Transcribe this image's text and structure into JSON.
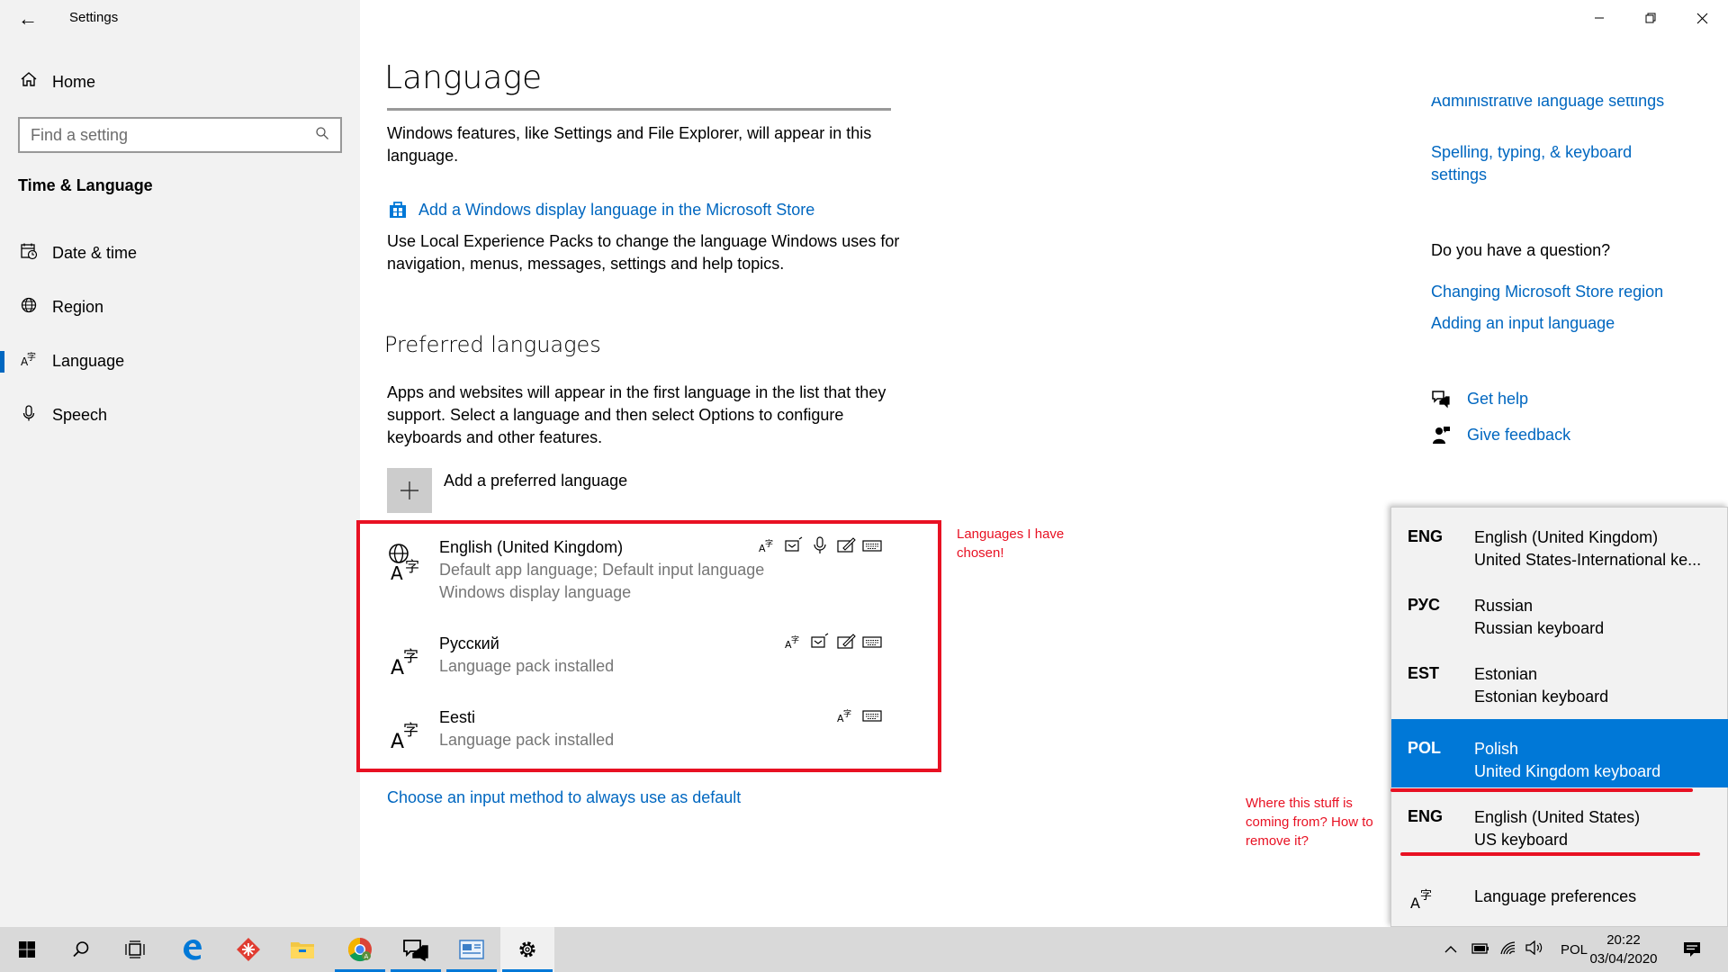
{
  "window": {
    "title": "Settings"
  },
  "sidebar": {
    "home": "Home",
    "search_placeholder": "Find a setting",
    "section": "Time & Language",
    "items": [
      {
        "label": "Date & time",
        "icon": "calendar-clock-icon"
      },
      {
        "label": "Region",
        "icon": "globe-icon"
      },
      {
        "label": "Language",
        "icon": "language-icon",
        "active": true
      },
      {
        "label": "Speech",
        "icon": "microphone-icon"
      }
    ]
  },
  "main": {
    "title": "Language",
    "display_desc": "Windows features, like Settings and File Explorer, will appear in this language.",
    "store_link": "Add a Windows display language in the Microsoft Store",
    "lxp_desc": "Use Local Experience Packs to change the language Windows uses for navigation, menus, messages, settings and help topics.",
    "preferred_heading": "Preferred languages",
    "preferred_desc": "Apps and websites will appear in the first language in the list that they support. Select a language and then select Options to configure keyboards and other features.",
    "add_preferred": "Add a preferred language",
    "languages": [
      {
        "name": "English (United Kingdom)",
        "sub1": "Default app language; Default input language",
        "sub2": "Windows display language"
      },
      {
        "name": "Русский",
        "sub1": "Language pack installed"
      },
      {
        "name": "Eesti",
        "sub1": "Language pack installed"
      }
    ],
    "choose_input": "Choose an input method to always use as default"
  },
  "annotations": {
    "chosen_line1": "Languages I have",
    "chosen_line2": "chosen!",
    "where_line1": "Where this stuff is",
    "where_line2": "coming from? How to",
    "where_line3": "remove it?"
  },
  "right": {
    "admin_link": "Administrative language settings",
    "spelling_link_1": "Spelling, typing, & keyboard",
    "spelling_link_2": "settings",
    "question": "Do you have a question?",
    "q_link1": "Changing Microsoft Store region",
    "q_link2": "Adding an input language",
    "get_help": "Get help",
    "give_feedback": "Give feedback"
  },
  "flyout": {
    "items": [
      {
        "code": "ENG",
        "lang": "English (United Kingdom)",
        "kbd": "United States-International ke..."
      },
      {
        "code": "РУС",
        "lang": "Russian",
        "kbd": "Russian keyboard"
      },
      {
        "code": "EST",
        "lang": "Estonian",
        "kbd": "Estonian keyboard"
      },
      {
        "code": "POL",
        "lang": "Polish",
        "kbd": "United Kingdom keyboard",
        "selected": true
      },
      {
        "code": "ENG",
        "lang": "English (United States)",
        "kbd": "US keyboard"
      }
    ],
    "prefs": "Language preferences"
  },
  "taskbar": {
    "input_indicator": "POL",
    "time": "20:22",
    "date": "03/04/2020",
    "accent": "#0078d7"
  },
  "colors": {
    "link": "#0067c0",
    "annotation": "#e81123",
    "selected": "#0078d7"
  }
}
